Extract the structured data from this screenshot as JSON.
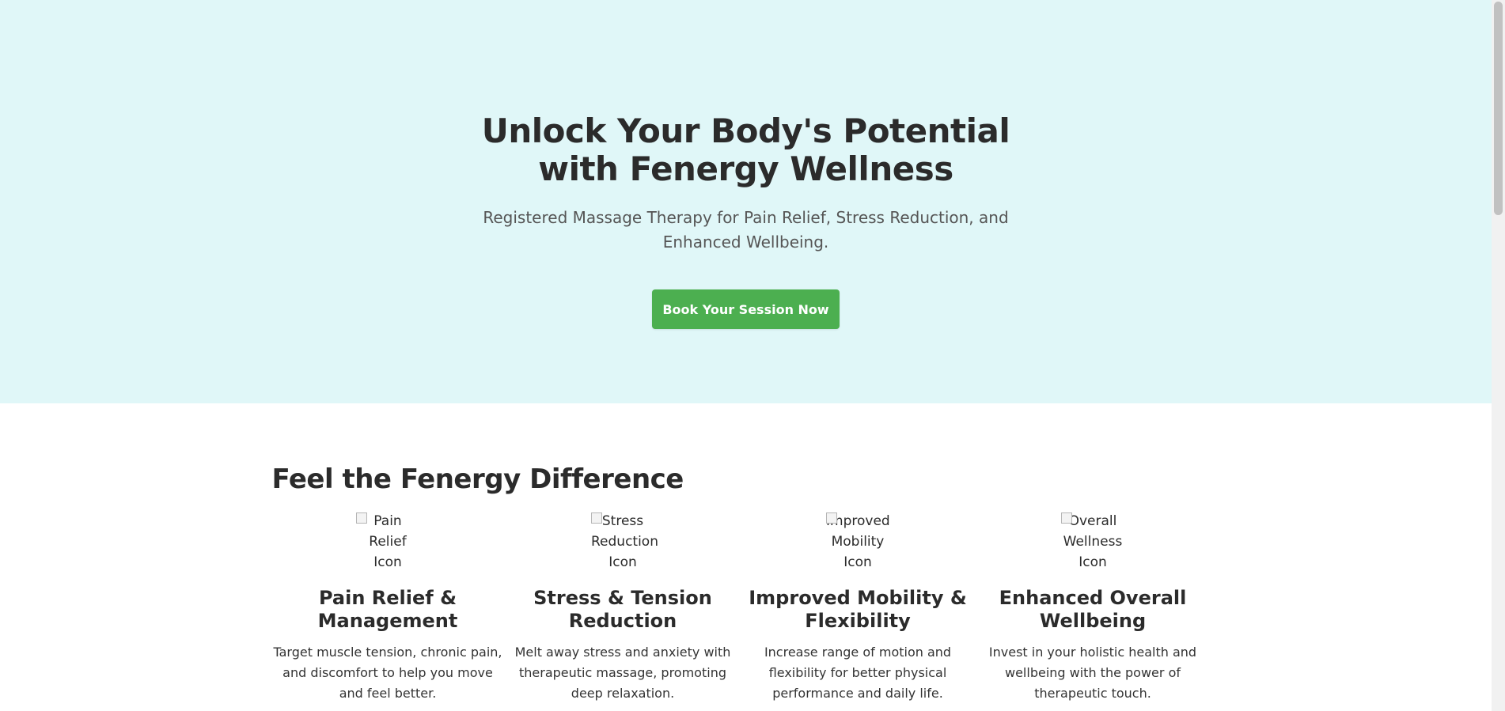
{
  "hero": {
    "title": "Unlock Your Body's Potential with Fenergy Wellness",
    "subtitle": "Registered Massage Therapy for Pain Relief, Stress Reduction, and Enhanced Wellbeing.",
    "cta_label": "Book Your Session Now",
    "background_color": "#e0f7f8",
    "cta_color": "#4caf50"
  },
  "features": {
    "title": "Feel the Fenergy Difference",
    "items": [
      {
        "icon_alt": "Pain Relief Icon",
        "heading": "Pain Relief & Management",
        "text": "Target muscle tension, chronic pain, and discomfort to help you move and feel better."
      },
      {
        "icon_alt": "Stress Reduction Icon",
        "heading": "Stress & Tension Reduction",
        "text": "Melt away stress and anxiety with therapeutic massage, promoting deep relaxation."
      },
      {
        "icon_alt": "Improved Mobility Icon",
        "heading": "Improved Mobility & Flexibility",
        "text": "Increase range of motion and flexibility for better physical performance and daily life."
      },
      {
        "icon_alt": "Overall Wellness Icon",
        "heading": "Enhanced Overall Wellbeing",
        "text": "Invest in your holistic health and wellbeing with the power of therapeutic touch."
      }
    ]
  }
}
